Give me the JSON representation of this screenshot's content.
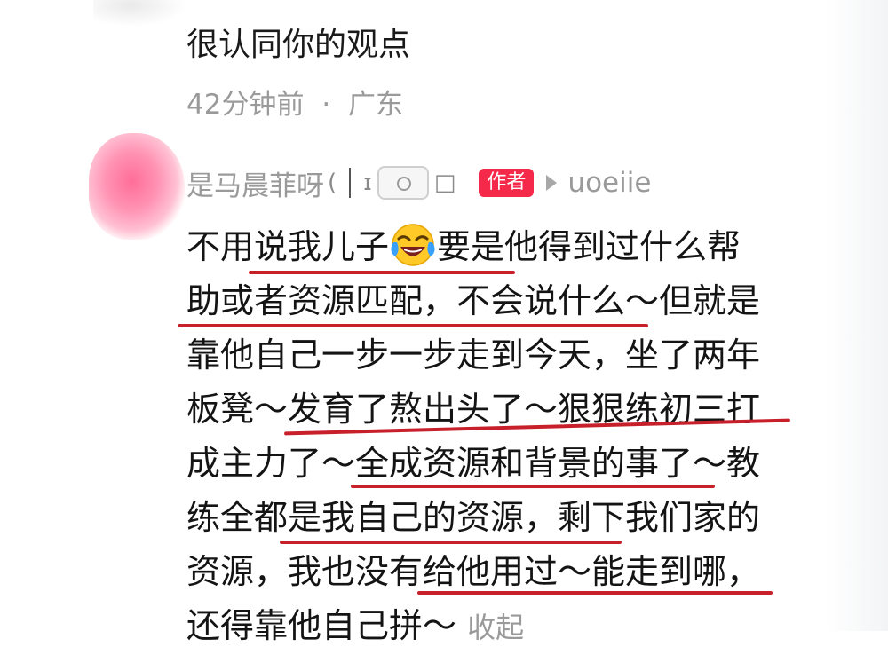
{
  "previous_comment": {
    "text": "很认同你的观点",
    "time": "42分钟前",
    "separator": "·",
    "location": "广东"
  },
  "reply": {
    "author_name": "是马晨菲呀",
    "author_badge": "作者",
    "reply_to": "uoeiie",
    "emoji_name": "laughing-crying-emoji",
    "lines": [
      {
        "before": "不用说我儿子",
        "after": "要是他得到过什么帮"
      },
      {
        "text": "助或者资源匹配，不会说什么～但就是"
      },
      {
        "text": "靠他自己一步一步走到今天，坐了两年"
      },
      {
        "text": "板凳～发育了熬出头了～狠狠练初三打"
      },
      {
        "text": "成主力了～全成资源和背景的事了～教"
      },
      {
        "text": "练全都是我自己的资源，剩下我们家的"
      },
      {
        "text": "资源，我也没有给他用过～能走到哪，"
      },
      {
        "text": "还得靠他自己拼～"
      }
    ],
    "collapse_label": "收起"
  },
  "colors": {
    "badge": "#f52a4a",
    "underline": "#c8202a",
    "meta_text": "#9a9a9a"
  }
}
